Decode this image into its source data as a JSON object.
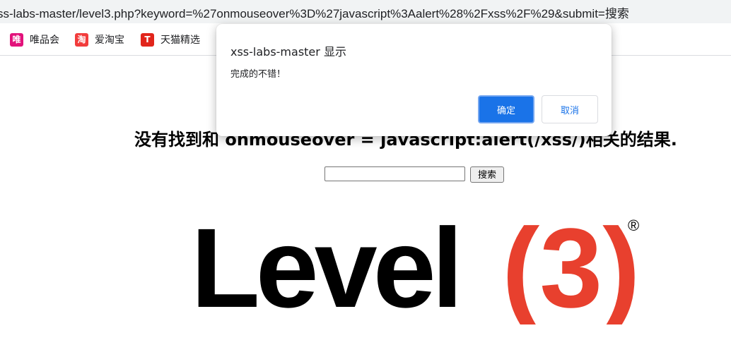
{
  "browser": {
    "url_visible": "ss-labs-master/level3.php?keyword=%27onmouseover%3D%27javascript%3Aalert%28%2Fxss%2F%29&submit=搜索",
    "bookmarks": [
      {
        "label": "唯品会",
        "icon": "vipshop-icon",
        "icon_glyph": "唯",
        "color": "#e2127b"
      },
      {
        "label": "爱淘宝",
        "icon": "taobao-icon",
        "icon_glyph": "淘",
        "color": "#f23c3c"
      },
      {
        "label": "天猫精选",
        "icon": "tmall-icon",
        "icon_glyph": "T",
        "color": "#e1251b"
      }
    ]
  },
  "page": {
    "headline": "没有找到和 onmouseover = javascript:alert(/xss/)相关的结果.",
    "search_input_value": "",
    "search_button_label": "搜索",
    "logo": {
      "text_main": "Level",
      "text_paren": "(3)",
      "registered": "®",
      "color_main": "#000000",
      "color_paren": "#e8402e"
    }
  },
  "dialog": {
    "title": "xss-labs-master 显示",
    "message": "完成的不错！",
    "ok_label": "确定",
    "cancel_label": "取消",
    "accent_color": "#1a73e8"
  }
}
